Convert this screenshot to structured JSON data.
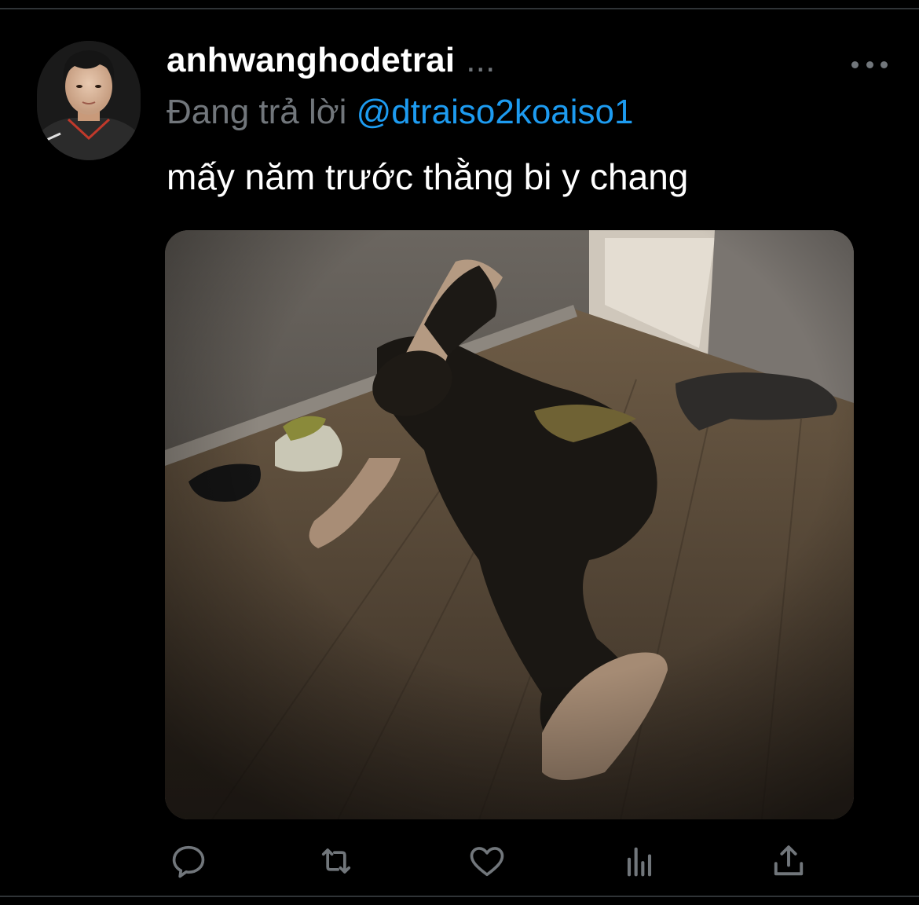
{
  "tweet": {
    "username": "anhwanghodetrai",
    "username_overflow": "...",
    "reply_prefix": "Đang trả lời",
    "reply_to": "@dtraiso2koaiso1",
    "text": "mấy năm trước thằng bi y chang"
  },
  "icons": {
    "more": "more-dots-icon",
    "reply": "reply-icon",
    "retweet": "retweet-icon",
    "like": "heart-icon",
    "views": "analytics-icon",
    "share": "share-icon"
  },
  "colors": {
    "background": "#000000",
    "text": "#ffffff",
    "muted": "#71767b",
    "accent": "#1d9bf0"
  }
}
